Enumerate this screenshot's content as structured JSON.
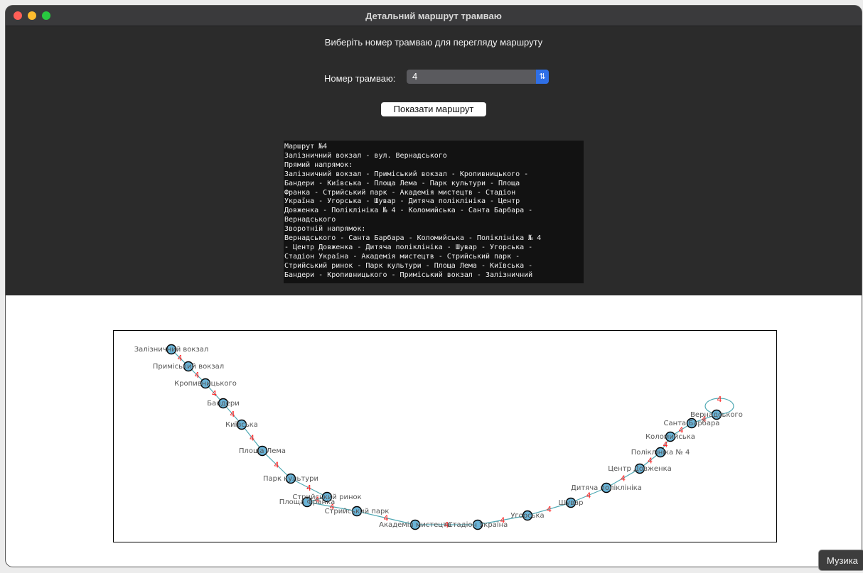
{
  "window": {
    "title": "Детальний маршрут трамваю"
  },
  "prompt": "Виберіть номер трамваю для перегляду маршруту",
  "tram_select": {
    "label": "Номер трамваю:",
    "value": "4"
  },
  "show_button": "Показати маршрут",
  "route_info": [
    "Маршрут №4",
    "Залізничний вокзал - вул. Вернадського",
    "Прямий напрямок:",
    "Залізничний вокзал - Приміський вокзал - Кропивницького -",
    "Бандери - Київська - Площа Лема - Парк культури - Площа",
    "Франка - Стрийський парк - Академія мистецтв - Стадіон",
    "Україна - Угорська - Шувар - Дитяча поліклініка - Центр",
    "Довженка - Поліклініка № 4 - Коломийська - Санта Барбара -",
    "Вернадського",
    "Зворотній напрямок:",
    "Вернадського - Санта Барбара - Коломийська - Поліклініка № 4",
    "- Центр Довженка - Дитяча поліклініка - Шувар - Угорська -",
    "Стадіон Україна - Академія мистецтв - Стрийський парк -",
    "Стрийський ринок - Парк культури - Площа Лема - Київська -",
    "Бандери - Кропивницького - Приміський вокзал - Залізничний"
  ],
  "graph": {
    "edge_label": "4",
    "edge_color": "#4fa8b3",
    "node_color": "#6ab4d8",
    "label_color": "#ff2020",
    "stops": [
      "Залізничний вокзал",
      "Приміський вокзал",
      "Кропивницького",
      "Бандери",
      "Київська",
      "Площа Лема",
      "Парк культури",
      "Стрийський ринок",
      "Площа Франка",
      "Стрийський парк",
      "Академія мистецтв",
      "Стадіон Україна",
      "Угорська",
      "Шувар",
      "Дитяча поліклініка",
      "Центр Довженка",
      "Поліклініка № 4",
      "Коломийська",
      "Санта Барбара",
      "Вернадського"
    ]
  },
  "tooltip": "Музика"
}
